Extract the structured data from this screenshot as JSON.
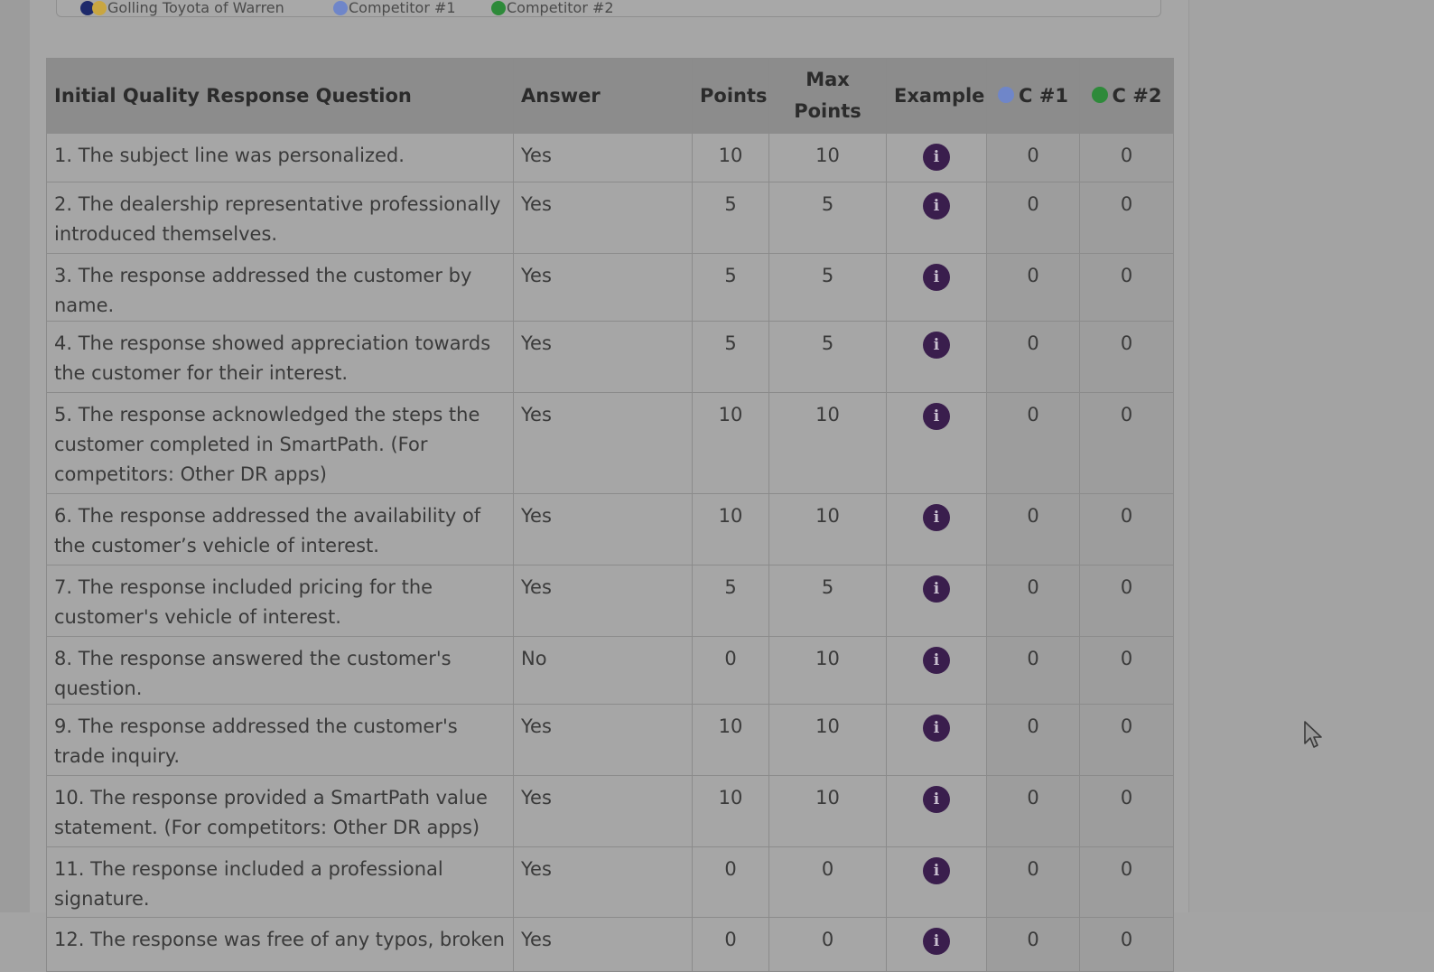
{
  "legend": {
    "items": [
      {
        "label": "Golling Toyota of Warren",
        "dot_colors": [
          "#1e2a6b",
          "#c9a641"
        ]
      },
      {
        "label": "Competitor #1",
        "dot_colors": [
          "#6f86c9"
        ]
      },
      {
        "label": "Competitor #2",
        "dot_colors": [
          "#2e8a3a"
        ]
      }
    ]
  },
  "table": {
    "headers": {
      "question": "Initial Quality Response Question",
      "answer": "Answer",
      "points": "Points",
      "max_points": "Max Points",
      "example": "Example",
      "c1": "C #1",
      "c2": "C #2"
    },
    "rows": [
      {
        "question": "1. The subject line was personalized.",
        "answer": "Yes",
        "points": "10",
        "max": "10",
        "c1": "0",
        "c2": "0"
      },
      {
        "question": "2. The dealership representative professionally introduced themselves.",
        "answer": "Yes",
        "points": "5",
        "max": "5",
        "c1": "0",
        "c2": "0"
      },
      {
        "question": "3. The response addressed the customer by name.",
        "answer": "Yes",
        "points": "5",
        "max": "5",
        "c1": "0",
        "c2": "0"
      },
      {
        "question": "4. The response showed appreciation towards the customer for their interest.",
        "answer": "Yes",
        "points": "5",
        "max": "5",
        "c1": "0",
        "c2": "0"
      },
      {
        "question": "5. The response acknowledged the steps the customer completed in SmartPath. (For competitors: Other DR apps)",
        "answer": "Yes",
        "points": "10",
        "max": "10",
        "c1": "0",
        "c2": "0"
      },
      {
        "question": "6. The response addressed the availability of the customer’s vehicle of interest.",
        "answer": "Yes",
        "points": "10",
        "max": "10",
        "c1": "0",
        "c2": "0"
      },
      {
        "question": "7. The response included pricing for the customer's vehicle of interest.",
        "answer": "Yes",
        "points": "5",
        "max": "5",
        "c1": "0",
        "c2": "0"
      },
      {
        "question": "8. The response answered the customer's question.",
        "answer": "No",
        "points": "0",
        "max": "10",
        "c1": "0",
        "c2": "0"
      },
      {
        "question": "9. The response addressed the customer's trade inquiry.",
        "answer": "Yes",
        "points": "10",
        "max": "10",
        "c1": "0",
        "c2": "0"
      },
      {
        "question": "10. The response provided a SmartPath value statement. (For competitors: Other DR apps)",
        "answer": "Yes",
        "points": "10",
        "max": "10",
        "c1": "0",
        "c2": "0"
      },
      {
        "question": "11. The response included a professional signature.",
        "answer": "Yes",
        "points": "0",
        "max": "0",
        "c1": "0",
        "c2": "0"
      },
      {
        "question": "12. The response was free of any typos, broken",
        "answer": "Yes",
        "points": "0",
        "max": "0",
        "c1": "0",
        "c2": "0"
      }
    ]
  },
  "icons": {
    "info": "info-circle-icon",
    "info_glyph": "i",
    "cursor": "mouse-pointer-icon"
  },
  "colors": {
    "info_icon": "#3a1e4d",
    "header_bg": "#8c8c8c",
    "c1_dot": "#6f86c9",
    "c2_dot": "#2e8a3a"
  }
}
